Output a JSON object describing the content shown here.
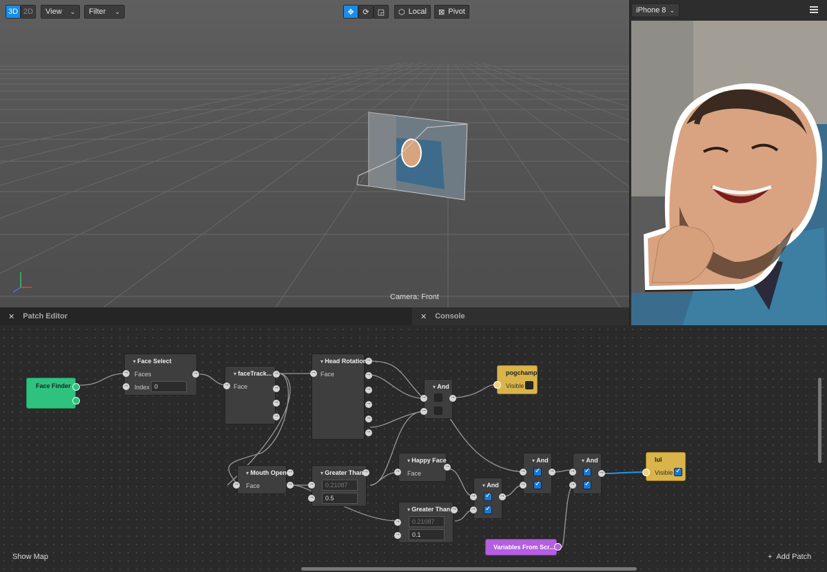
{
  "toolbar": {
    "mode_3d": "3D",
    "mode_2d": "2D",
    "view": "View",
    "filter": "Filter",
    "local": "Local",
    "pivot": "Pivot"
  },
  "viewport": {
    "camera_label": "Camera: Front"
  },
  "preview": {
    "device": "iPhone 8"
  },
  "panels": {
    "patch_editor": "Patch Editor",
    "console": "Console"
  },
  "patches": {
    "face_finder": {
      "title": "Face Finder"
    },
    "face_select": {
      "title": "Face Select",
      "faces": "Faces",
      "index_label": "Index",
      "index_value": "0"
    },
    "face_tracker": {
      "title": "faceTrack...",
      "face": "Face"
    },
    "head_rotation": {
      "title": "Head Rotation",
      "face": "Face"
    },
    "and1": {
      "title": "And"
    },
    "pogchamp": {
      "title": "pogchamp",
      "visible": "Visible"
    },
    "mouth_open": {
      "title": "Mouth Open",
      "face": "Face"
    },
    "greater_than1": {
      "title": "Greater Than",
      "value_a": "0.21087",
      "value_b": "0.5"
    },
    "happy_face": {
      "title": "Happy Face",
      "face": "Face"
    },
    "greater_than2": {
      "title": "Greater Than",
      "value_a": "0.21087",
      "value_b": "0.1"
    },
    "and2": {
      "title": "And"
    },
    "and3": {
      "title": "And"
    },
    "and4": {
      "title": "And"
    },
    "lul": {
      "title": "lul",
      "visible": "Visible"
    },
    "variables": {
      "title": "Variables From Scr..."
    }
  },
  "footer": {
    "show_map": "Show Map",
    "add_patch": "Add Patch"
  },
  "colors": {
    "accent": "#1a8ceb",
    "green": "#2ec27e",
    "yellow": "#d9b44a",
    "purple": "#b45ee0",
    "checkbox": "#1778d6"
  }
}
